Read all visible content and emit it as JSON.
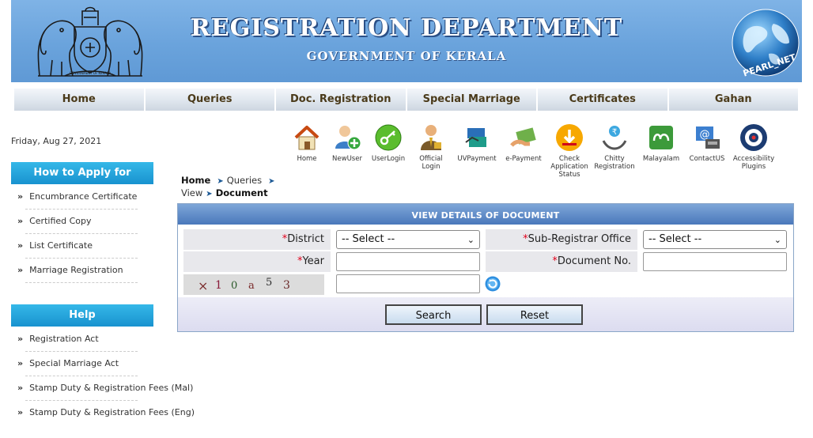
{
  "header": {
    "title": "REGISTRATION DEPARTMENT",
    "subtitle": "GOVERNMENT OF KERALA",
    "globe_text": "PEARL_NET",
    "emblem_text": "GOVERNMENT OF KERALA"
  },
  "nav": [
    "Home",
    "Queries",
    "Doc. Registration",
    "Special Marriage",
    "Certificates",
    "Gahan"
  ],
  "date": "Friday, Aug 27, 2021",
  "quick_links": [
    {
      "label": "Home",
      "icon": "home-icon"
    },
    {
      "label": "NewUser",
      "icon": "new-user-icon"
    },
    {
      "label": "UserLogin",
      "icon": "user-login-icon"
    },
    {
      "label": "Official Login",
      "icon": "official-login-icon"
    },
    {
      "label": "UVPayment",
      "icon": "uv-payment-icon"
    },
    {
      "label": "e-Payment",
      "icon": "e-payment-icon"
    },
    {
      "label": "Check Application Status",
      "icon": "check-status-icon"
    },
    {
      "label": "Chitty Registration",
      "icon": "chitty-registration-icon"
    },
    {
      "label": "Malayalam",
      "icon": "malayalam-icon"
    },
    {
      "label": "ContactUS",
      "icon": "contact-us-icon"
    },
    {
      "label": "Accessibility Plugins",
      "icon": "accessibility-icon"
    }
  ],
  "sidebar": {
    "how_to_apply": {
      "title": "How to Apply for",
      "items": [
        "Encumbrance Certificate",
        "Certified Copy",
        "List Certificate",
        "Marriage Registration"
      ]
    },
    "help": {
      "title": "Help",
      "items": [
        "Registration Act",
        "Special Marriage Act",
        "Stamp Duty & Registration Fees (Mal)",
        "Stamp Duty & Registration Fees (Eng)"
      ]
    }
  },
  "breadcrumb": {
    "home": "Home",
    "queries": "Queries",
    "view": "View",
    "current": "Document"
  },
  "form": {
    "title": "VIEW DETAILS OF DOCUMENT",
    "required_mark": "*",
    "district_label": "District",
    "district_value": "-- Select --",
    "sro_label": "Sub-Registrar Office",
    "sro_value": "-- Select --",
    "year_label": "Year",
    "year_value": "",
    "doc_no_label": "Document No.",
    "doc_no_value": "",
    "captcha_chars": [
      "×",
      "1",
      "0",
      "a",
      "5",
      "3"
    ],
    "captcha_input": "",
    "search_label": "Search",
    "reset_label": "Reset"
  },
  "colors": {
    "banner": "#6aa3dc",
    "sidebar_header": "#1892cf",
    "panel_header": "#4a78bb",
    "required": "#e0001a"
  }
}
